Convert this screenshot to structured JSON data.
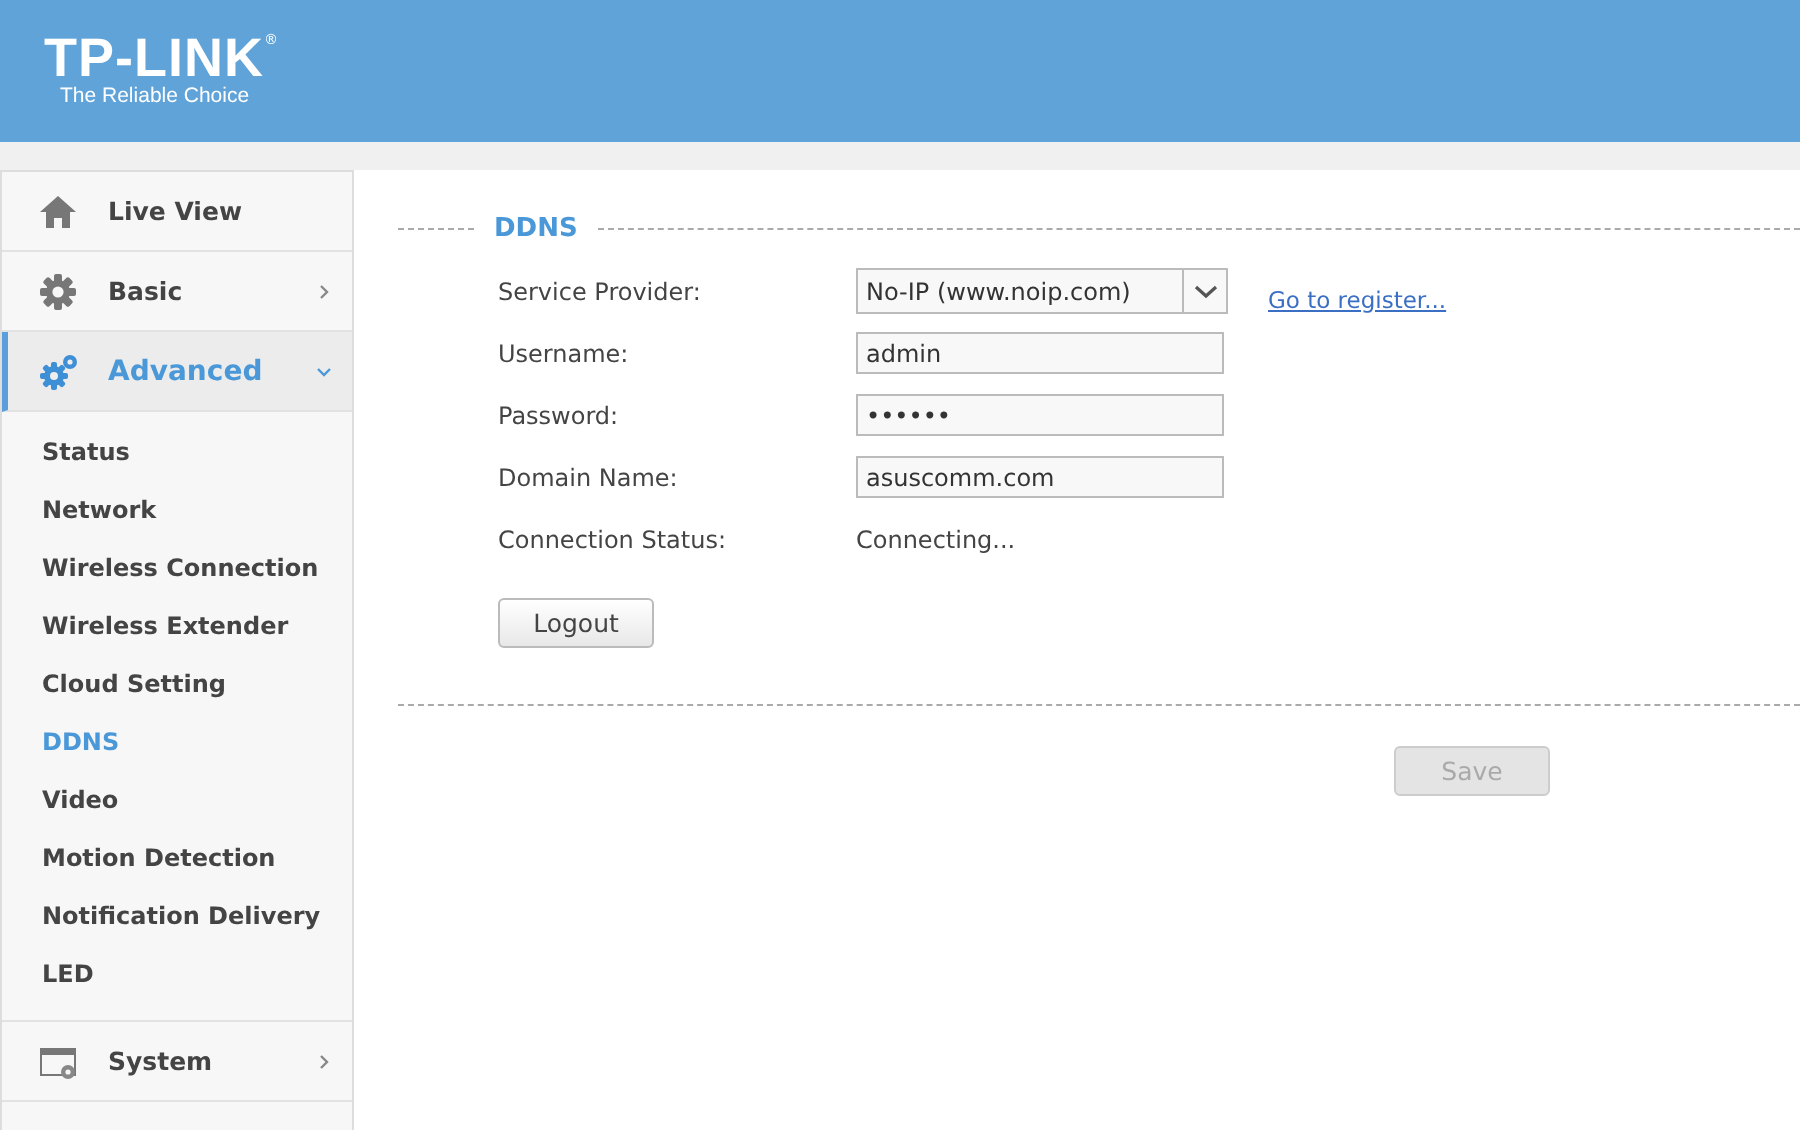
{
  "header": {
    "logo": "TP-LINK",
    "trademark": "®",
    "tagline": "The Reliable Choice"
  },
  "sidebar": {
    "items": [
      {
        "label": "Live View",
        "kind": "link",
        "selected": false
      },
      {
        "label": "Basic",
        "kind": "group",
        "selected": false,
        "expanded": false
      },
      {
        "label": "Advanced",
        "kind": "group",
        "selected": true,
        "expanded": true,
        "children": [
          {
            "label": "Status",
            "selected": false
          },
          {
            "label": "Network",
            "selected": false
          },
          {
            "label": "Wireless Connection",
            "selected": false
          },
          {
            "label": "Wireless Extender",
            "selected": false
          },
          {
            "label": "Cloud Setting",
            "selected": false
          },
          {
            "label": "DDNS",
            "selected": true
          },
          {
            "label": "Video",
            "selected": false
          },
          {
            "label": "Motion Detection",
            "selected": false
          },
          {
            "label": "Notification Delivery",
            "selected": false
          },
          {
            "label": "LED",
            "selected": false
          }
        ]
      },
      {
        "label": "System",
        "kind": "group",
        "selected": false,
        "expanded": false
      }
    ]
  },
  "section": {
    "title": "DDNS",
    "fields": [
      {
        "label": "Service Provider:",
        "kind": "select",
        "value": "No-IP (www.noip.com)",
        "link": "Go to register..."
      },
      {
        "label": "Username:",
        "kind": "text",
        "value": "admin"
      },
      {
        "label": "Password:",
        "kind": "text",
        "value": "••••••"
      },
      {
        "label": "Domain Name:",
        "kind": "text",
        "value": "asuscomm.com"
      },
      {
        "label": "Connection Status:",
        "kind": "status",
        "value": "Connecting..."
      }
    ],
    "action": {
      "label": "Logout",
      "disabled": false
    }
  },
  "save": {
    "label": "Save",
    "disabled": true
  }
}
